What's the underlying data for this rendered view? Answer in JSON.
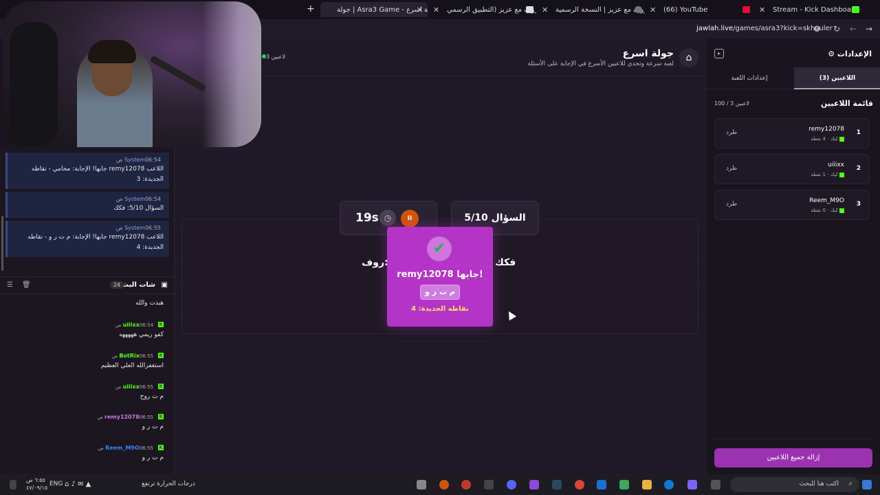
{
  "browser": {
    "tabs": [
      {
        "label": "Stream - Kick Dashboard"
      },
      {
        "label": "(66) YouTube"
      },
      {
        "label": "حروف مع عزيز | النسخة الرسمية"
      },
      {
        "label": "حروف مع عزيز (التطبيق الرسمي..."
      },
      {
        "label": "جولة | Asra3 Game - جولة اسرع"
      }
    ],
    "url_host": "jawlah.live",
    "url_path": "/games/asra3?kick=skhouler"
  },
  "left_chat": {
    "system_messages": [
      {
        "sender": "System",
        "time": "06:54 ص",
        "body": "اللاعب remy12078 جابها! الإجابة: محامي - نقاطه الجديدة: 3"
      },
      {
        "sender": "System",
        "time": "06:54 ص",
        "body": "السؤال 5/10: فكك"
      },
      {
        "sender": "System",
        "time": "06:55 ص",
        "body": "اللاعب remy12078 جابها! الإجابة: م ت ر و - نقاطه الجديدة: 4"
      }
    ],
    "header_title": "شات البث",
    "header_count": "24",
    "messages": [
      {
        "user": "",
        "time": "",
        "text": "هبدت والله",
        "color": "#53fc18"
      },
      {
        "user": "uiiixx",
        "time": "06:54 ص",
        "text": "كفو ريمي هههههه",
        "color": "#53fc18"
      },
      {
        "user": "BotRix",
        "time": "06:55 ص",
        "text": "استغفرالله العلي العظيم",
        "color": "#53fc18"
      },
      {
        "user": "uiiixx",
        "time": "06:55 ص",
        "text": "م ت روح",
        "color": "#53fc18"
      },
      {
        "user": "remy12078",
        "time": "06:55 ص",
        "text": "م ت ر و",
        "color": "#c678dd"
      },
      {
        "user": "Reem_M9O",
        "time": "06:55 ص",
        "text": "م ت ر و",
        "color": "#3b82f6"
      }
    ]
  },
  "game": {
    "title": "جولة اسرع",
    "subtitle": "لعبة سرعة وتحدي للاعبين الأسرع في الإجابة على الأسئلة",
    "players_online": "3 لاعبين",
    "question_counter": "السؤال 5/10",
    "timer": "19s",
    "question_right": "فكك",
    "question_left": "روف:",
    "winner_title": "remy12078 جابها!",
    "winner_answer": "م ت ر و",
    "winner_points": "نقاطه الجديدة: 4"
  },
  "settings": {
    "title": "الإعدادات",
    "tab_players": "اللاعبين (3)",
    "tab_game": "إعدادات اللعبة",
    "players_heading": "قائمة اللاعبين",
    "players_capacity": "100 / 3 لاعبين",
    "kick_label": "طرد",
    "players": [
      {
        "rank": "1",
        "name": "remy12078",
        "platform": "كيك",
        "points": "4 نقطة"
      },
      {
        "rank": "2",
        "name": "uiiixx",
        "platform": "كيك",
        "points": "1 نقطة"
      },
      {
        "rank": "3",
        "name": "Reem_M9O",
        "platform": "كيك",
        "points": "0 نقطة"
      }
    ],
    "remove_all": "إزالة جميع اللاعبين"
  },
  "taskbar": {
    "search_placeholder": "اكتب هنا للبحث",
    "weather": "درجات الحرارة ترتفع",
    "lang": "ENG",
    "time": "٦:٥٥ ص",
    "date": "٤٧/٠٩/١٥"
  }
}
